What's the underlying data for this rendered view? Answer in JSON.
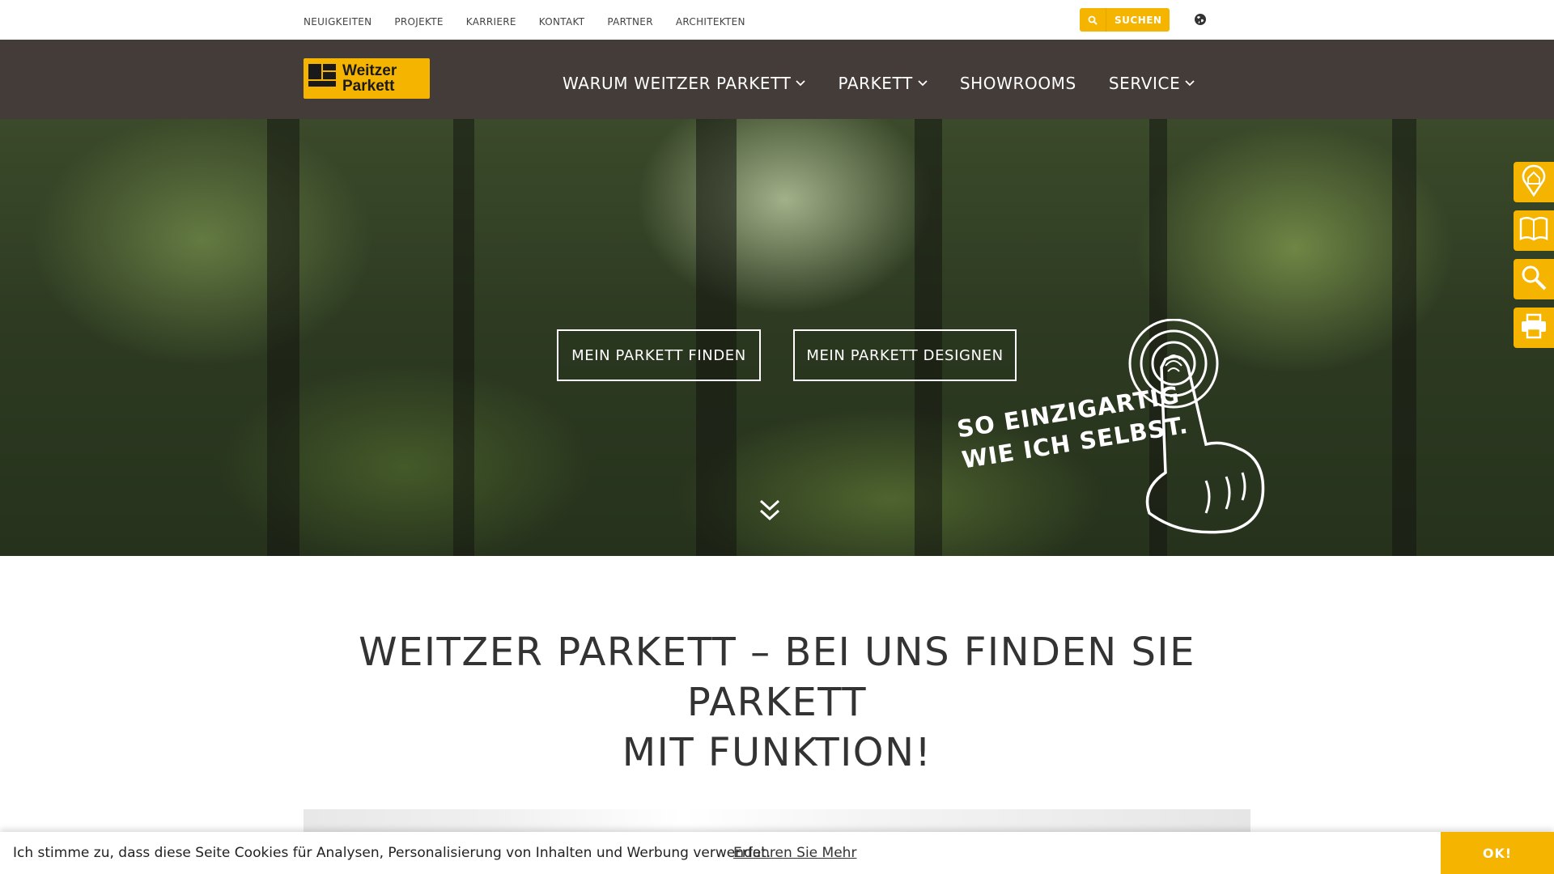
{
  "topnav": {
    "items": [
      "NEUIGKEITEN",
      "PROJEKTE",
      "KARRIERE",
      "KONTAKT",
      "PARTNER",
      "ARCHITEKTEN"
    ]
  },
  "search": {
    "label": "SUCHEN"
  },
  "logo": {
    "line1": "Weitzer",
    "line2": "Parkett"
  },
  "mainnav": {
    "items": [
      {
        "label": "WARUM WEITZER PARKETT"
      },
      {
        "label": "PARKETT"
      },
      {
        "label": "SHOWROOMS"
      },
      {
        "label": "SERVICE"
      }
    ]
  },
  "hero": {
    "find_button": "MEIN PARKETT FINDEN",
    "design_button": "MEIN PARKETT DESIGNEN",
    "slogan_line1": "SO EINZIGARTIG",
    "slogan_line2": "WIE ICH SELBST."
  },
  "headline": {
    "line1": "WEITZER PARKETT – BEI UNS FINDEN SIE PARKETT",
    "line2": "MIT FUNKTION!"
  },
  "cookie": {
    "message": "Ich stimme zu, dass diese Seite Cookies für Analysen, Personalisierung von Inhalten und Werbung verwendet.",
    "more_link": "Erfahren Sie Mehr",
    "ok_button": "OK!"
  },
  "colors": {
    "accent": "#f5b400",
    "nav_bg": "#443c39"
  },
  "icons": {
    "sidetools": [
      "location-house-icon",
      "book-icon",
      "magnifier-icon",
      "printer-icon"
    ]
  }
}
